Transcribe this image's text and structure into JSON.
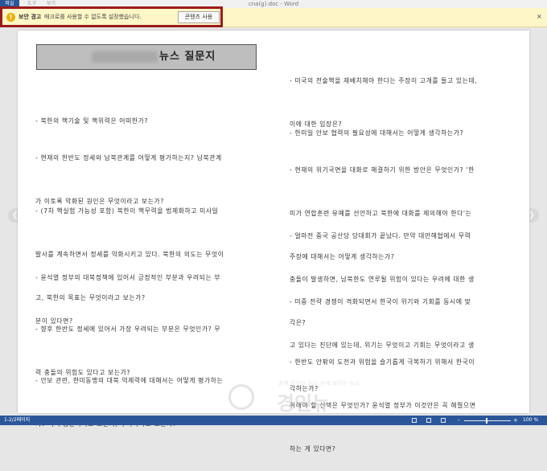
{
  "window": {
    "title": "cna(g).doc - Word",
    "file_tab": "파일",
    "menu_tabs": [
      "도구",
      "보기"
    ]
  },
  "security_bar": {
    "title": "보안 경고",
    "message": "매크로를 사용할 수 없도록 설정했습니다.",
    "button_label": "콘텐츠 사용",
    "close": "×",
    "icon": "warning-icon",
    "highlight_color": "#9b1b1b"
  },
  "document": {
    "header_title": "뉴스 질문지",
    "left_questions": [
      [
        "- 북한의 핵기술 및 핵위력은 어떠한가?"
      ],
      [
        "- 현재의 한반도 정세와 남북관계를 어떻게 평가하는지? 남북관계",
        "가 이토록 악화된 원인은 무엇이라고 보는가?"
      ],
      [
        "- (7차 핵실험 가능성 포함) 북한이 핵무력을 법제화하고 미사일",
        "발사를 계속하면서 정세를 악화시키고 있다. 북한의 의도는 무엇이",
        "고, 북한의 목표는 무엇이라고 보는가?"
      ],
      [
        "- 윤석열 정부의 대북정책에 있어서 긍정적인 부분과 우려되는 부",
        "분이 있다면?"
      ],
      [
        "- 향후 한반도 정세에 있어서 가장 우려되는 부분은 무엇인가? 무",
        "력 충돌의 위험도 있다고 보는가?"
      ],
      [
        "- 안보 관련, 한미동맹의 대북 억제력에 대해서는 어떻게 평가하는",
        "가? 이미 충분하다고 보는가, 부족하다고 보는가?"
      ]
    ],
    "right_questions": [
      [
        "- 미국의 전술핵을 재배치해야 한다는 주장이 고개를 들고 있는데,",
        "이에 대한 입장은?"
      ],
      [
        "- 한미일 안보 협력의 필요성에 대해서는 어떻게 생각하는가?"
      ],
      [
        "- 현재의 위기국면을 대화로 해결하기 위한 방안은 무엇인가? '한",
        "미가 연합훈련 유예를 선언하고 북한에 대화를 제의해야 한다'는",
        "주장에 대해서는 어떻게 생각하는가?"
      ],
      [
        "- 얼마전 중국 공산당 당대회가 끝났다. 만약 대만해협에서 무력",
        "충돌이 발생하면, 남북한도 연루될 위험이 있다는 우려에 대한 생",
        "각은?"
      ],
      [
        "- 미중 전략 경쟁이 격화되면서 한국이 위기와 기회를 동시에 맞",
        "고 있다는 진단에 있는데, 위기는 무엇이고 기회는 무엇이라고 생",
        "각하는가?"
      ],
      [
        "- 한반도 안팎의 도전과 위험을 슬기롭게 극복하기 위해서 한국이",
        "취해야 할 선택은 무엇인가? 윤석열 정부가 이것만은 꼭 해줬으면",
        "하는 게 있다면?"
      ]
    ]
  },
  "watermark": {
    "small_text": "손에 잡히는 뉴스 눈에 보이는 뉴스",
    "big_text": "경인뉴"
  },
  "statusbar": {
    "page_count": "1-2/2페이지",
    "zoom_minus": "-",
    "zoom_plus": "+",
    "zoom_level": "100 %",
    "zoom_value": 100
  }
}
